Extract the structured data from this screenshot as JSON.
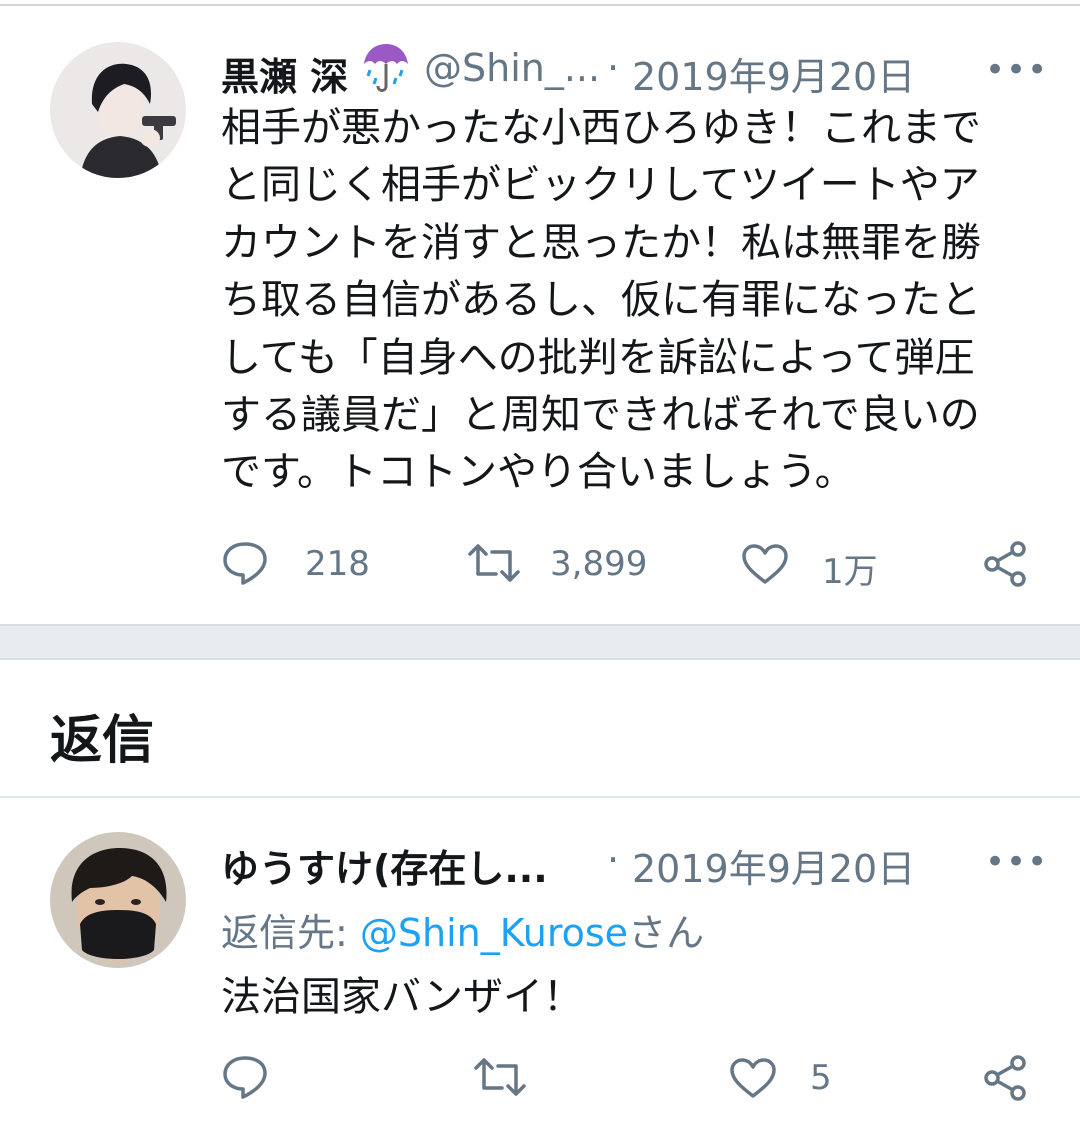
{
  "tweet": {
    "display_name": "黒瀬 深",
    "name_emoji": "☔",
    "handle": "@Shin_...",
    "dot": "·",
    "date": "2019年9月20日",
    "more": "•••",
    "text": "相手が悪かったな小西ひろゆき！これまで\nと同じく相手がビックリしてツイートやア\nカウントを消すと思ったか！私は無罪を勝\nち取る自信があるし、仮に有罪になったと\nしても「自身への批判を訴訟によって弾圧\nする議員だ」と周知できればそれで良いの\nです。トコトンやり合いましょう。",
    "reply_count": "218",
    "retweet_count": "3,899",
    "like_count": "1万"
  },
  "section_title": "返信",
  "reply": {
    "display_name": "ゆうすけ(存在し...",
    "dot": "·",
    "date": "2019年9月20日",
    "more": "•••",
    "replying_to_label": "返信先: ",
    "replying_to_handle": "@Shin_Kurose",
    "replying_to_suffix": "さん",
    "text": "法治国家バンザイ！",
    "like_count": "5"
  },
  "colors": {
    "text": "#14171a",
    "secondary": "#657786",
    "link": "#1da1f2",
    "separator": "#e6ecf0"
  },
  "icons": [
    "reply-icon",
    "retweet-icon",
    "like-icon",
    "share-icon",
    "more-icon",
    "umbrella-emoji"
  ]
}
